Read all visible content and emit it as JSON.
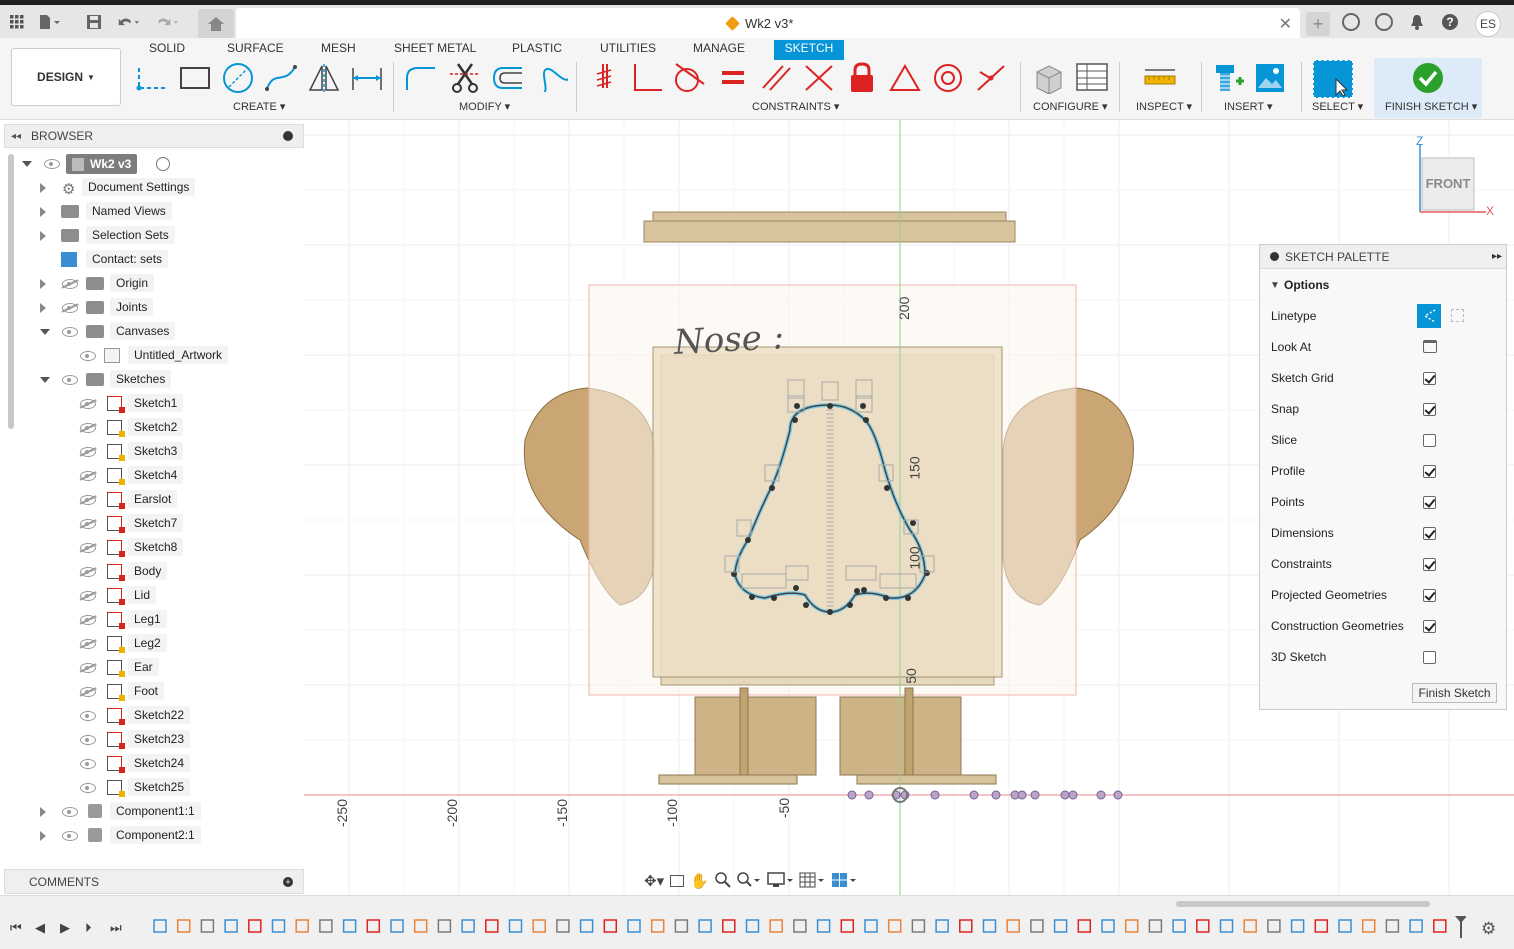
{
  "app": {
    "document_title": "Wk2 v3*",
    "user_initials": "ES"
  },
  "toolbar": {
    "workspace_label": "DESIGN",
    "tabs": [
      "SOLID",
      "SURFACE",
      "MESH",
      "SHEET METAL",
      "PLASTIC",
      "UTILITIES",
      "MANAGE",
      "SKETCH"
    ],
    "active_tab": "SKETCH",
    "groups": {
      "create": "CREATE",
      "modify": "MODIFY",
      "constraints": "CONSTRAINTS",
      "configure": "CONFIGURE",
      "inspect": "INSPECT",
      "insert": "INSERT",
      "select": "SELECT",
      "finish": "FINISH SKETCH"
    },
    "accent_color": "#0696d7"
  },
  "browser": {
    "title": "BROWSER",
    "root": "Wk2 v3",
    "items": [
      {
        "label": "Document Settings",
        "icon": "gear-icon"
      },
      {
        "label": "Named Views",
        "icon": "folder-icon"
      },
      {
        "label": "Selection Sets",
        "icon": "folder-icon"
      },
      {
        "label": "Contact: sets",
        "icon": "contact-sets-icon"
      },
      {
        "label": "Origin",
        "icon": "folder-icon"
      },
      {
        "label": "Joints",
        "icon": "folder-icon"
      },
      {
        "label": "Canvases",
        "icon": "folder-icon"
      },
      {
        "label": "Untitled_Artwork",
        "icon": "canvas-image-icon"
      },
      {
        "label": "Sketches",
        "icon": "folder-icon"
      }
    ],
    "sketches": [
      "Sketch1",
      "Sketch2",
      "Sketch3",
      "Sketch4",
      "Earslot",
      "Sketch7",
      "Sketch8",
      "Body",
      "Lid",
      "Leg1",
      "Leg2",
      "Ear",
      "Foot",
      "Sketch22",
      "Sketch23",
      "Sketch24",
      "Sketch25"
    ],
    "components": [
      "Component1:1",
      "Component2:1"
    ]
  },
  "comments": {
    "title": "COMMENTS"
  },
  "canvas": {
    "annotation": "Nose :",
    "vertical_ticks": [
      "200",
      "150",
      "100",
      "50"
    ],
    "horizontal_ticks": [
      "-250",
      "-200",
      "-150",
      "-100",
      "-50"
    ],
    "viewcube_face": "FRONT",
    "axis_z": "Z",
    "axis_x": "X"
  },
  "palette": {
    "title": "SKETCH PALETTE",
    "section": "Options",
    "linetype_label": "Linetype",
    "look_at_label": "Look At",
    "options": [
      {
        "label": "Sketch Grid",
        "checked": true
      },
      {
        "label": "Snap",
        "checked": true
      },
      {
        "label": "Slice",
        "checked": false
      },
      {
        "label": "Profile",
        "checked": true
      },
      {
        "label": "Points",
        "checked": true
      },
      {
        "label": "Dimensions",
        "checked": true
      },
      {
        "label": "Constraints",
        "checked": true
      },
      {
        "label": "Projected Geometries",
        "checked": true
      },
      {
        "label": "Construction Geometries",
        "checked": true
      },
      {
        "label": "3D Sketch",
        "checked": false
      }
    ],
    "finish_button": "Finish Sketch"
  }
}
